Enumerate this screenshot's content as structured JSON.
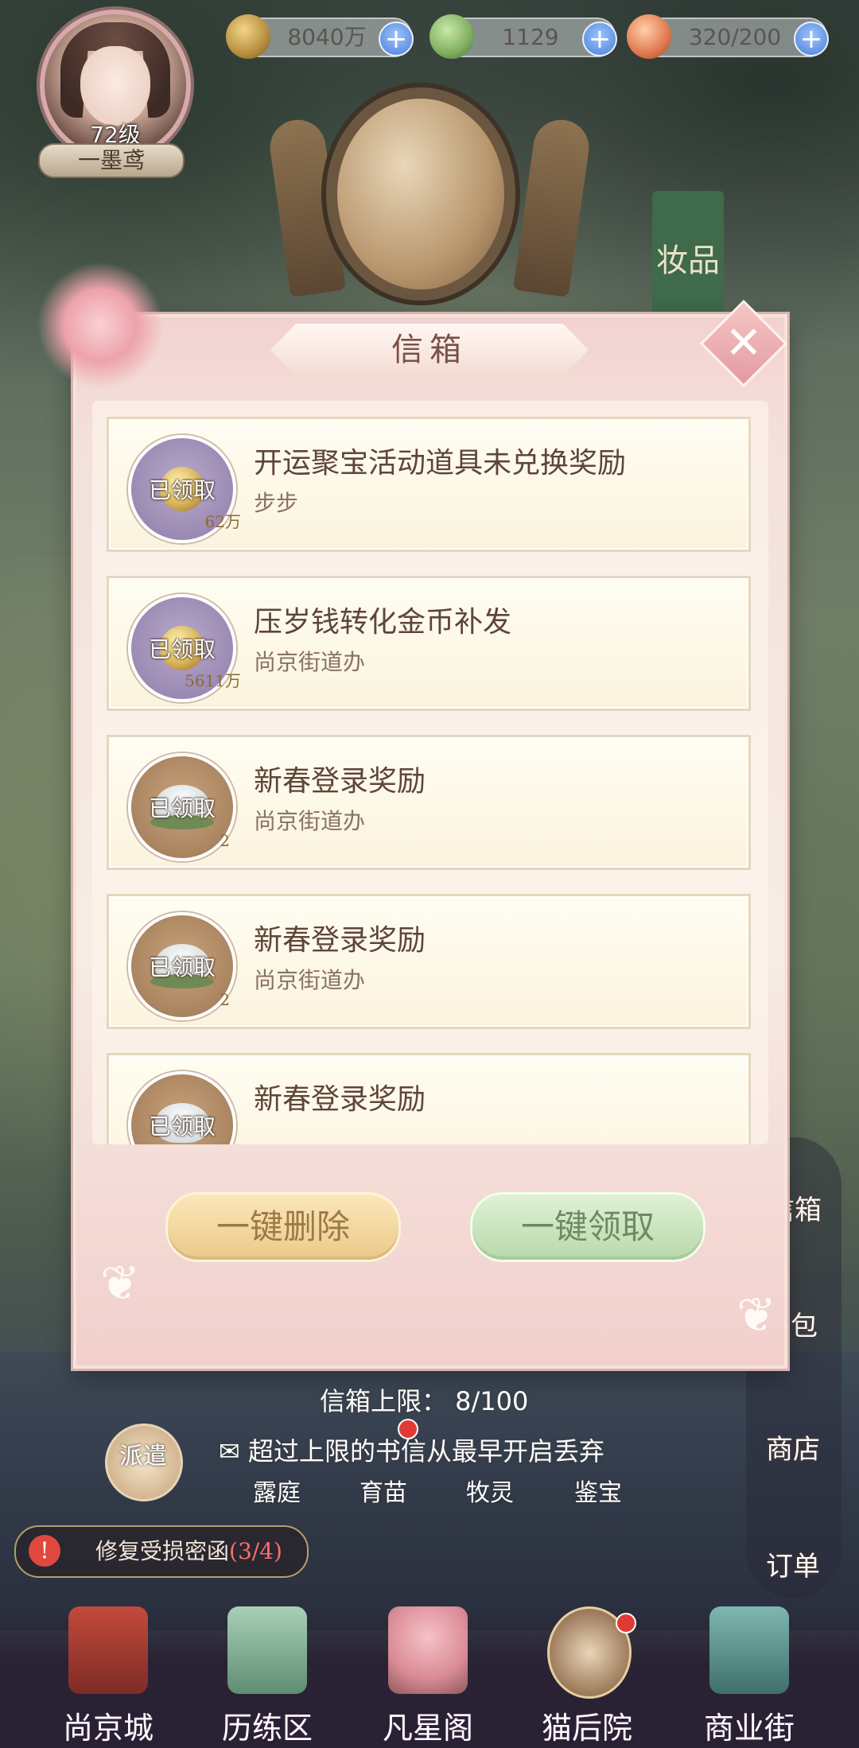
{
  "hud": {
    "level": "72级",
    "player_name": "一墨鸢",
    "resources": [
      {
        "icon": "paw-coin-icon",
        "value": "8040万"
      },
      {
        "icon": "sprout-bird-icon",
        "value": "1129"
      },
      {
        "icon": "bun-stamina-icon",
        "value": "320/200"
      }
    ],
    "plus": "+"
  },
  "scene": {
    "sign_text": "妆品"
  },
  "mailbox": {
    "title": "信箱",
    "close": "✕",
    "claimed_label": "已领取",
    "items": [
      {
        "title": "开运聚宝活动道具未兑换奖励",
        "sender": "步步",
        "quantity": "62万",
        "icon": "coin"
      },
      {
        "title": "压岁钱转化金币补发",
        "sender": "尚京街道办",
        "quantity": "5611万",
        "icon": "coin"
      },
      {
        "title": "新春登录奖励",
        "sender": "尚京街道办",
        "quantity": "2",
        "icon": "flower"
      },
      {
        "title": "新春登录奖励",
        "sender": "尚京街道办",
        "quantity": "2",
        "icon": "flower"
      },
      {
        "title": "新春登录奖励",
        "sender": "",
        "quantity": "",
        "icon": "flower"
      }
    ],
    "delete_all": "一键删除",
    "claim_all": "一键领取",
    "limit_text": "信箱上限：  8/100",
    "notice_text": "超过上限的书信从最早开启丢弃"
  },
  "side": {
    "mailbox": "信箱",
    "bag": "包",
    "shop": "商店",
    "orders": "订单"
  },
  "subnav": [
    "露庭",
    "育苗",
    "牧灵",
    "鉴宝"
  ],
  "dispatch": "派遣",
  "repair": {
    "label": "修复受损密函",
    "count": "(3/4)"
  },
  "bottom_nav": [
    "尚京城",
    "历练区",
    "凡星阁",
    "猫后院",
    "商业街"
  ]
}
